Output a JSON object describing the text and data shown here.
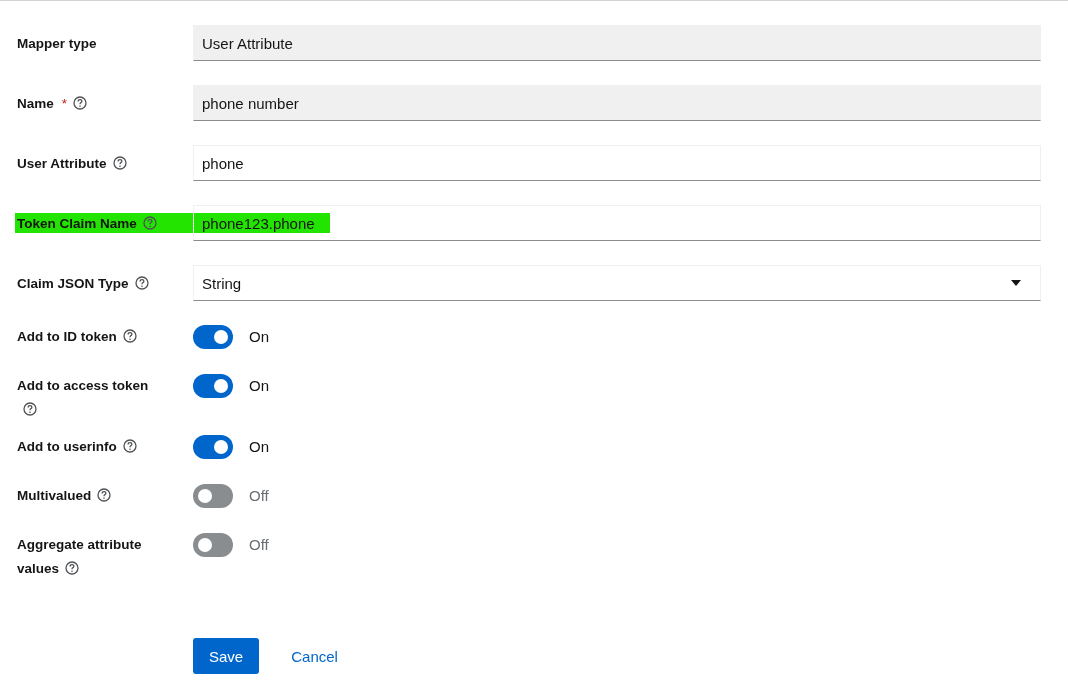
{
  "fields": [
    {
      "label": "Mapper type",
      "kind": "readonly",
      "value": "User Attribute",
      "help": false,
      "highlighted": false
    },
    {
      "label": "Name",
      "required_mark": "*",
      "kind": "readonly",
      "value": "phone number",
      "help": true,
      "highlighted": false
    },
    {
      "label": "User Attribute",
      "kind": "text",
      "value": "phone",
      "help": true,
      "highlighted": false
    },
    {
      "label": "Token Claim Name",
      "kind": "text",
      "value": "phone123.phone",
      "help": true,
      "highlighted": true
    },
    {
      "label": "Claim JSON Type",
      "kind": "select",
      "value": "String",
      "help": true,
      "highlighted": false
    }
  ],
  "switches": [
    {
      "label": "Add to ID token",
      "on": true,
      "state_text": "On"
    },
    {
      "label": "Add to access token",
      "on": true,
      "state_text": "On"
    },
    {
      "label": "Add to userinfo",
      "on": true,
      "state_text": "On"
    },
    {
      "label": "Multivalued",
      "on": false,
      "state_text": "Off"
    },
    {
      "label": "Aggregate attribute values",
      "on": false,
      "state_text": "Off"
    }
  ],
  "buttons": [
    {
      "label": "Save",
      "kind": "primary"
    },
    {
      "label": "Cancel",
      "kind": "link"
    }
  ]
}
